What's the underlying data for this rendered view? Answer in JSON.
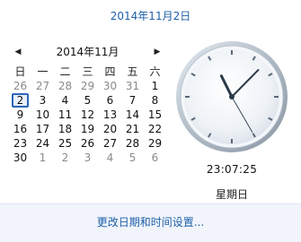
{
  "header": {
    "date_link": "2014年11月2日"
  },
  "calendar": {
    "prev_icon": "triangle-left-icon",
    "next_icon": "triangle-right-icon",
    "month_title": "2014年11月",
    "weekdays": [
      "日",
      "一",
      "二",
      "三",
      "四",
      "五",
      "六"
    ],
    "weeks": [
      [
        {
          "d": "26",
          "o": true
        },
        {
          "d": "27",
          "o": true
        },
        {
          "d": "28",
          "o": true
        },
        {
          "d": "29",
          "o": true
        },
        {
          "d": "30",
          "o": true
        },
        {
          "d": "31",
          "o": true
        },
        {
          "d": "1"
        }
      ],
      [
        {
          "d": "2",
          "t": true
        },
        {
          "d": "3"
        },
        {
          "d": "4"
        },
        {
          "d": "5"
        },
        {
          "d": "6"
        },
        {
          "d": "7"
        },
        {
          "d": "8"
        }
      ],
      [
        {
          "d": "9"
        },
        {
          "d": "10"
        },
        {
          "d": "11"
        },
        {
          "d": "12"
        },
        {
          "d": "13"
        },
        {
          "d": "14"
        },
        {
          "d": "15"
        }
      ],
      [
        {
          "d": "16"
        },
        {
          "d": "17"
        },
        {
          "d": "18"
        },
        {
          "d": "19"
        },
        {
          "d": "20"
        },
        {
          "d": "21"
        },
        {
          "d": "22"
        }
      ],
      [
        {
          "d": "23"
        },
        {
          "d": "24"
        },
        {
          "d": "25"
        },
        {
          "d": "26"
        },
        {
          "d": "27"
        },
        {
          "d": "28"
        },
        {
          "d": "29"
        }
      ],
      [
        {
          "d": "30"
        },
        {
          "d": "1",
          "o": true
        },
        {
          "d": "2",
          "o": true
        },
        {
          "d": "3",
          "o": true
        },
        {
          "d": "4",
          "o": true
        },
        {
          "d": "5",
          "o": true
        },
        {
          "d": "6",
          "o": true
        }
      ]
    ]
  },
  "clock": {
    "hours": 23,
    "minutes": 7,
    "seconds": 25,
    "time_text": "23:07:25",
    "weekday_text": "星期日",
    "colors": {
      "hand": "#2b3a4a",
      "second_hand": "#3a4a5a",
      "face_outer": "#c9d3dc",
      "face_inner": "#f7f9fb"
    }
  },
  "footer": {
    "settings_link": "更改日期和时间设置..."
  },
  "colors": {
    "link": "#1e5fa8",
    "today_border": "#2a66b8",
    "other_month": "#8a8a8a"
  }
}
